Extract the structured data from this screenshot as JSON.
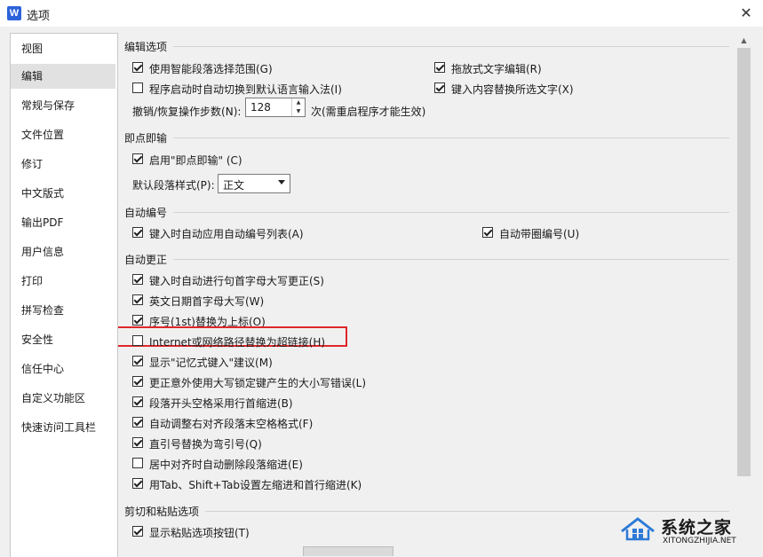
{
  "window": {
    "title": "选项",
    "app_icon_letter": "W"
  },
  "sidebar": {
    "items": [
      {
        "label": "视图"
      },
      {
        "label": "编辑",
        "active": true
      },
      {
        "label": "常规与保存"
      },
      {
        "label": "文件位置"
      },
      {
        "label": "修订"
      },
      {
        "label": "中文版式"
      },
      {
        "label": "输出PDF"
      },
      {
        "label": "用户信息"
      },
      {
        "label": "打印"
      },
      {
        "label": "拼写检查"
      },
      {
        "label": "安全性"
      },
      {
        "label": "信任中心"
      },
      {
        "label": "自定义功能区"
      },
      {
        "label": "快速访问工具栏"
      }
    ]
  },
  "edit_options": {
    "title": "编辑选项",
    "smart_para": {
      "label": "使用智能段落选择范围(G)",
      "checked": true
    },
    "drag_drop": {
      "label": "拖放式文字编辑(R)",
      "checked": true
    },
    "auto_ime": {
      "label": "程序启动时自动切换到默认语言输入法(I)",
      "checked": false
    },
    "replace_sel": {
      "label": "键入内容替换所选文字(X)",
      "checked": true
    },
    "undo_label": "撤销/恢复操作步数(N):",
    "undo_value": "128",
    "undo_hint": "次(需重启程序才能生效)"
  },
  "click_type": {
    "title": "即点即输",
    "enable": {
      "label": "启用\"即点即输\" (C)",
      "checked": true
    },
    "style_label": "默认段落样式(P):",
    "style_value": "正文"
  },
  "auto_number": {
    "title": "自动编号",
    "auto_list": {
      "label": "键入时自动应用自动编号列表(A)",
      "checked": true
    },
    "circle_num": {
      "label": "自动带圈编号(U)",
      "checked": true
    }
  },
  "auto_correct": {
    "title": "自动更正",
    "items": [
      {
        "label": "键入时自动进行句首字母大写更正(S)",
        "checked": true
      },
      {
        "label": "英文日期首字母大写(W)",
        "checked": true
      },
      {
        "label": "序号(1st)替换为上标(O)",
        "checked": true
      },
      {
        "label": "Internet或网络路径替换为超链接(H)",
        "checked": false
      },
      {
        "label": "显示\"记忆式键入\"建议(M)",
        "checked": true
      },
      {
        "label": "更正意外使用大写锁定键产生的大小写错误(L)",
        "checked": true
      },
      {
        "label": "段落开头空格采用行首缩进(B)",
        "checked": true
      },
      {
        "label": "自动调整右对齐段落末空格格式(F)",
        "checked": true
      },
      {
        "label": "直引号替换为弯引号(Q)",
        "checked": true
      },
      {
        "label": "居中对齐时自动删除段落缩进(E)",
        "checked": false
      },
      {
        "label": "用Tab、Shift+Tab设置左缩进和首行缩进(K)",
        "checked": true
      }
    ]
  },
  "paste": {
    "title": "剪切和粘贴选项",
    "show_btn": {
      "label": "显示粘贴选项按钮(T)",
      "checked": true
    }
  },
  "watermark": {
    "title": "系统之家",
    "url": "XITONGZHIJIA.NET"
  },
  "colors": {
    "highlight": "#e0262b",
    "app_icon": "#2b62d9"
  }
}
